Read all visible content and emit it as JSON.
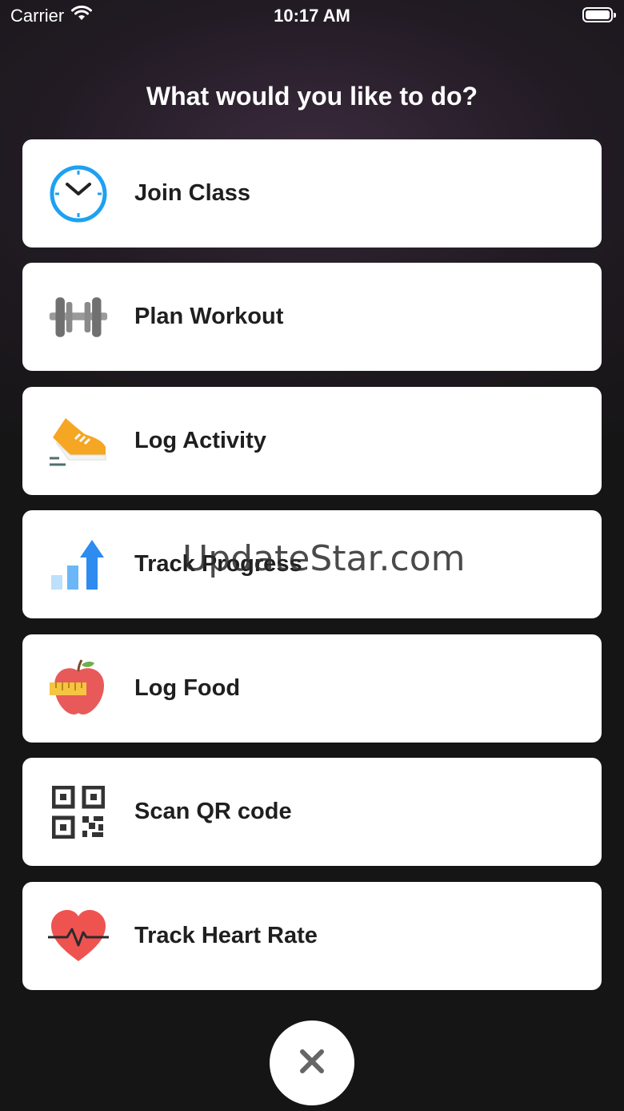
{
  "status_bar": {
    "carrier": "Carrier",
    "time": "10:17 AM"
  },
  "heading": "What would you like to do?",
  "actions": [
    {
      "label": "Join Class",
      "icon": "clock-icon"
    },
    {
      "label": "Plan Workout",
      "icon": "dumbbell-icon"
    },
    {
      "label": "Log Activity",
      "icon": "running-shoe-icon"
    },
    {
      "label": "Track Progress",
      "icon": "progress-chart-icon"
    },
    {
      "label": "Log Food",
      "icon": "apple-icon"
    },
    {
      "label": "Scan QR code",
      "icon": "qr-code-icon"
    },
    {
      "label": "Track Heart Rate",
      "icon": "heart-rate-icon"
    }
  ],
  "watermark": "UpdateStar.com",
  "close_icon": "close-icon",
  "colors": {
    "clock_blue": "#1da1f2",
    "shoe_orange": "#f5a623",
    "chart_blue": "#2e8bf0",
    "apple_red": "#e85a5a",
    "heart_red": "#ef5350"
  }
}
